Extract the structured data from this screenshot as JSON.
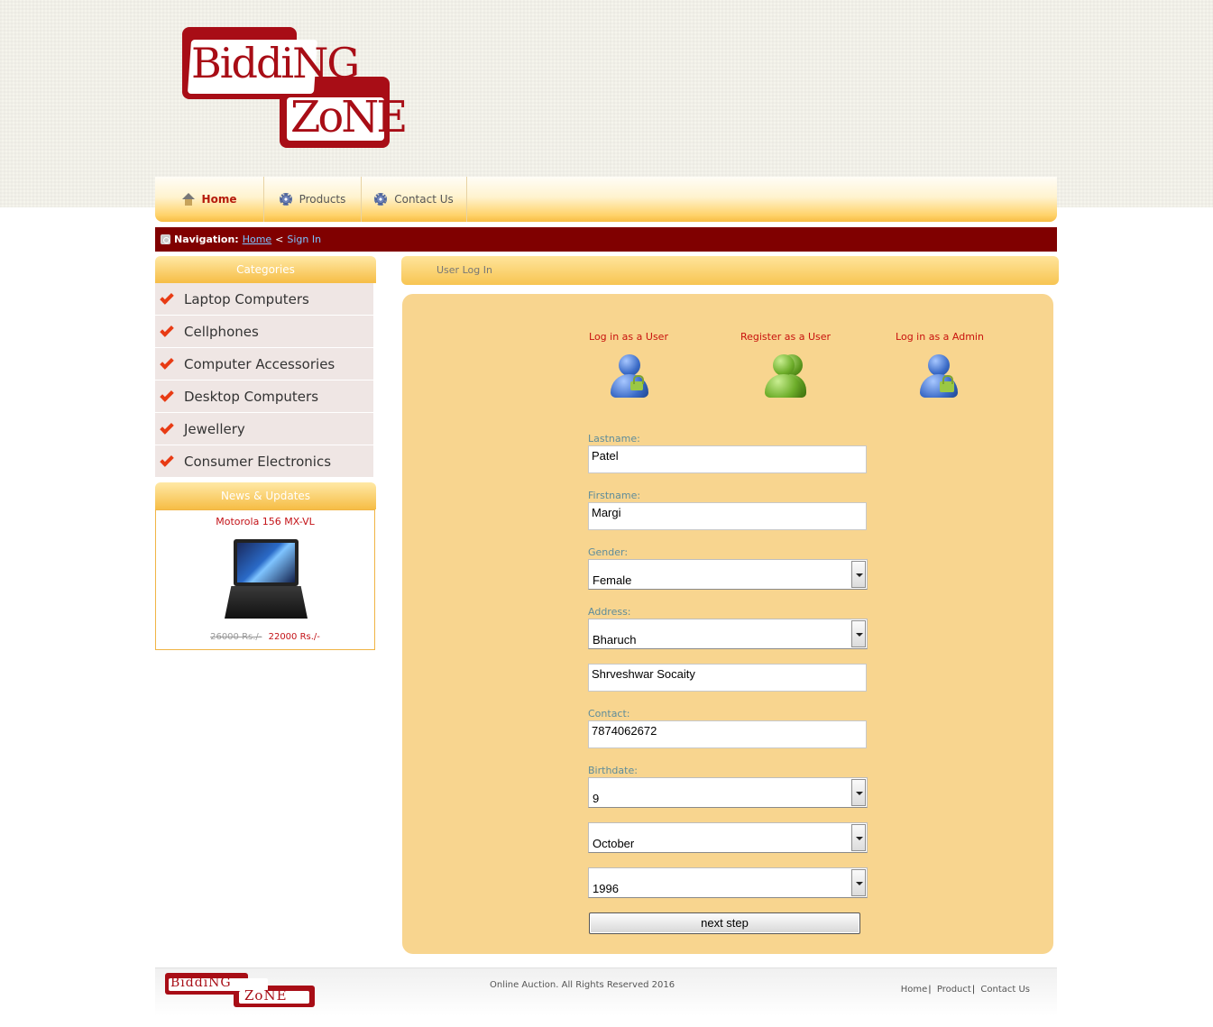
{
  "logo": {
    "line1": "BiddiNG",
    "line2": "ZoNE"
  },
  "nav": {
    "items": [
      {
        "label": "Home",
        "icon": "home-icon",
        "active": true
      },
      {
        "label": "Products",
        "icon": "gear-icon",
        "active": false
      },
      {
        "label": "Contact Us",
        "icon": "gear-icon",
        "active": false
      }
    ]
  },
  "breadcrumb": {
    "label": "Navigation:",
    "home": "Home",
    "separator": "<",
    "current": "Sign In"
  },
  "sidebar": {
    "categories_title": "Categories",
    "categories": [
      "Laptop Computers",
      "Cellphones",
      "Computer Accessories",
      "Desktop Computers",
      "Jewellery",
      "Consumer Electronics"
    ],
    "news_title": "News & Updates",
    "news": {
      "product": "Motorola 156 MX-VL",
      "old_price": "26000 Rs./-",
      "new_price": "22000 Rs./-"
    }
  },
  "main": {
    "title": "User Log In",
    "options": [
      {
        "label": "Log in as a User",
        "icon": "user-login-icon"
      },
      {
        "label": "Register as a User",
        "icon": "register-user-icon"
      },
      {
        "label": "Log in as a Admin",
        "icon": "admin-login-icon"
      }
    ],
    "form": {
      "lastname_label": "Lastname:",
      "lastname": "Patel",
      "firstname_label": "Firstname:",
      "firstname": "Margi",
      "gender_label": "Gender:",
      "gender": "Female",
      "address_label": "Address:",
      "city": "Bharuch",
      "street": "Shrveshwar Socaity",
      "contact_label": "Contact:",
      "contact": "7874062672",
      "birthdate_label": "Birthdate:",
      "day": "9",
      "month": "October",
      "year": "1996",
      "submit": "next step"
    }
  },
  "footer": {
    "logo_line1": "BiddiNG",
    "logo_line2": "ZoNE",
    "copyright": "Online Auction. All Rights Reserved 2016",
    "links": [
      "Home",
      "Product",
      "Contact Us"
    ],
    "separator": "|"
  },
  "colors": {
    "brand_red": "#a80d16",
    "breadcrumb_bg": "#800000",
    "panel_bg": "#f8d58f",
    "link_red": "#c8120e",
    "label_teal": "#5e8c9a"
  }
}
